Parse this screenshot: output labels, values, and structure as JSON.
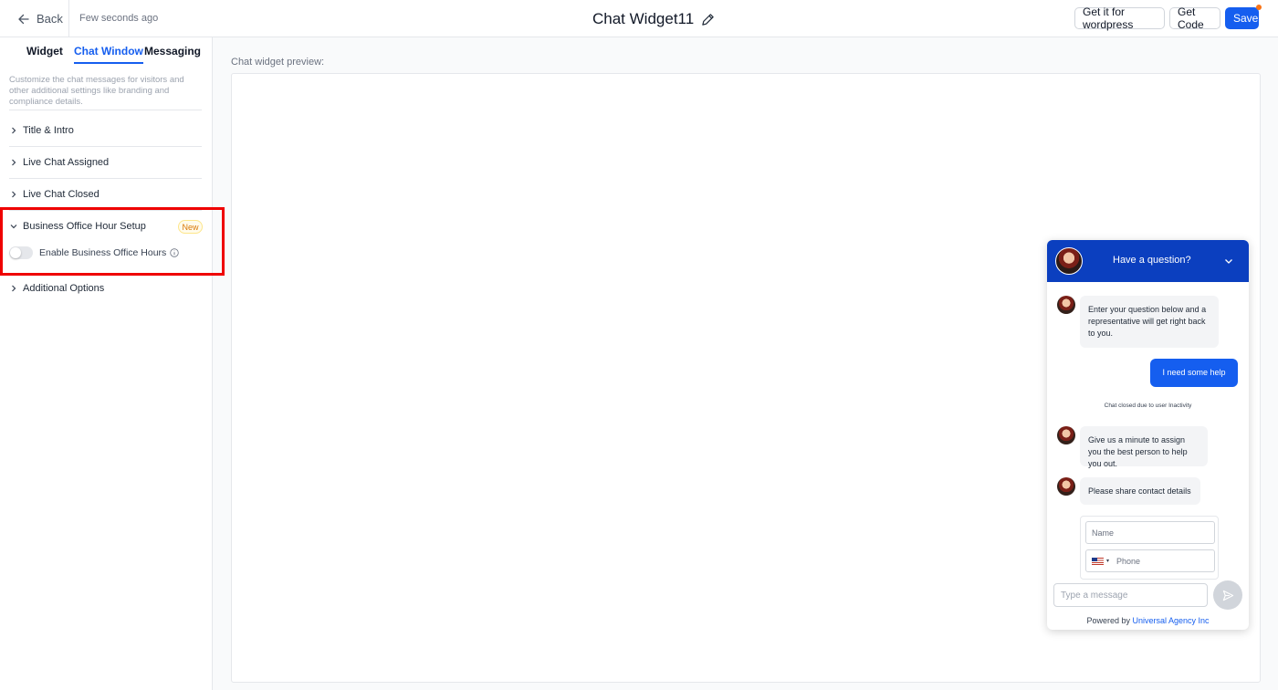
{
  "header": {
    "back_label": "Back",
    "saved_status": "Few seconds ago",
    "title": "Chat Widget11",
    "buttons": {
      "wordpress": "Get it for wordpress",
      "get_code": "Get Code",
      "save": "Save"
    }
  },
  "sidebar": {
    "tabs": [
      "Widget",
      "Chat Window",
      "Messaging"
    ],
    "active_tab": "Chat Window",
    "description": "Customize the chat messages for visitors and other additional settings like branding and compliance details.",
    "sections": [
      "Title & Intro",
      "Live Chat Assigned",
      "Live Chat Closed",
      "Business Office Hour Setup",
      "Additional Options"
    ],
    "business_badge": "New",
    "business_toggle": {
      "label": "Enable Business Office Hours",
      "enabled": false
    }
  },
  "main": {
    "preview_label": "Chat widget preview:"
  },
  "widget": {
    "header_title": "Have a question?",
    "messages": {
      "intro": "Enter your question below and a representative will get right back to you.",
      "user": "I need some help",
      "system": "Chat closed due to user Inactivity",
      "assign": "Give us a minute to assign you the best person to help you out.",
      "contact": "Please share contact details"
    },
    "form": {
      "name_placeholder": "Name",
      "phone_placeholder": "Phone"
    },
    "input_placeholder": "Type a message",
    "powered_by": "Powered by",
    "brand": "Universal Agency Inc"
  },
  "colors": {
    "primary": "#155eef",
    "widget_header": "#0b3fbf",
    "highlight": "#ef0000",
    "badge": "#d97706"
  },
  "icons": [
    "arrow-left-icon",
    "pencil-icon",
    "chevron-right-icon",
    "chevron-down-icon",
    "info-icon",
    "send-icon",
    "us-flag-icon"
  ]
}
